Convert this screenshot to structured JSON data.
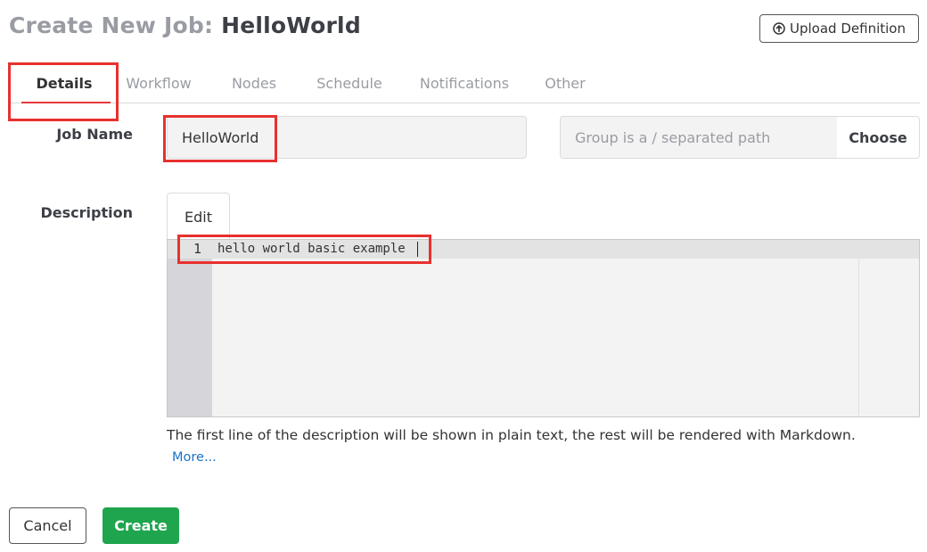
{
  "header": {
    "title_prefix": "Create New Job:",
    "job_title": "HelloWorld",
    "upload_label": "Upload Definition"
  },
  "tabs": [
    {
      "label": "Details",
      "active": true
    },
    {
      "label": "Workflow",
      "active": false
    },
    {
      "label": "Nodes",
      "active": false
    },
    {
      "label": "Schedule",
      "active": false
    },
    {
      "label": "Notifications",
      "active": false
    },
    {
      "label": "Other",
      "active": false
    }
  ],
  "form": {
    "job_name_label": "Job Name",
    "job_name_value": "HelloWorld",
    "group_placeholder": "Group is a / separated path",
    "choose_label": "Choose",
    "description_label": "Description",
    "edit_tab_label": "Edit",
    "editor": {
      "line_number": "1",
      "line_text": "hello world basic example"
    },
    "help_text": "The first line of the description will be shown in plain text, the rest will be rendered with Markdown.",
    "more_link": "More..."
  },
  "actions": {
    "cancel_label": "Cancel",
    "create_label": "Create"
  },
  "colors": {
    "accent_tab_underline": "#e4393c",
    "highlight_box": "#e8312f",
    "create_button": "#1ea54d",
    "link": "#1a73c8"
  },
  "icons": {
    "upload": "circle-arrow-up-icon"
  }
}
